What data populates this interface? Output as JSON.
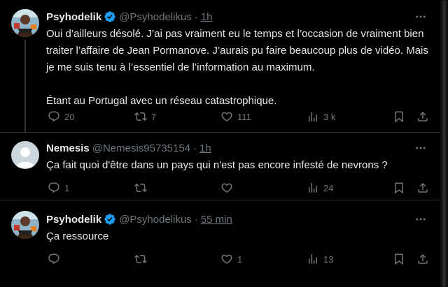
{
  "posts": [
    {
      "name": "Psyhodelik",
      "verified": true,
      "handle": "@Psyhodelikus",
      "separator": "·",
      "time": "1h",
      "paragraphs": [
        "Oui d’ailleurs désolé. J’ai pas vraiment eu le temps et l’occasion de vraiment bien traiter l’affaire de Jean Pormanove. J’aurais pu faire beaucoup plus de vidéo.  Mais je me suis tenu à l’essentiel de l’information au maximum.",
        "Étant au Portugal avec un réseau catastrophique."
      ],
      "replies": "20",
      "reposts": "7",
      "likes": "111",
      "views": "3 k"
    },
    {
      "name": "Nemesis",
      "verified": false,
      "handle": "@Nemesis95735154",
      "separator": "·",
      "time": "1h",
      "paragraphs": [
        "Ça fait quoi d'être dans un pays qui n'est pas encore infesté de nevrons ?"
      ],
      "replies": "1",
      "reposts": "",
      "likes": "",
      "views": "24"
    },
    {
      "name": "Psyhodelik",
      "verified": true,
      "handle": "@Psyhodelikus",
      "separator": "·",
      "time": "55 min",
      "paragraphs": [
        "Ça ressource"
      ],
      "replies": "",
      "reposts": "",
      "likes": "1",
      "views": "13"
    }
  ],
  "icons": {
    "reply": "reply-icon",
    "repost": "repost-icon",
    "like": "like-icon",
    "views": "views-icon",
    "bookmark": "bookmark-icon",
    "share": "share-icon",
    "more": "more-icon",
    "verified": "verified-badge-icon"
  },
  "colors": {
    "background": "#000000",
    "text": "#e7e9ea",
    "muted": "#71767b",
    "verified": "#1d9bf0",
    "divider": "#2f3336"
  }
}
